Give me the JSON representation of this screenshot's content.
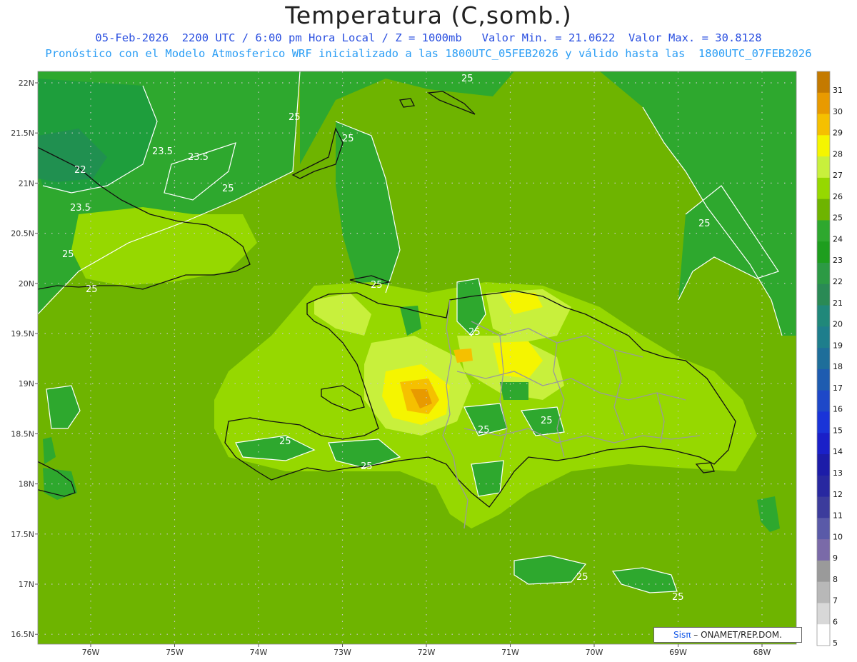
{
  "title": "Temperatura (C,somb.)",
  "subtitle_line1": "05-Feb-2026  2200 UTC / 6:00 pm Hora Local / Z = 1000mb   Valor Min. = 21.0622  Valor Max. = 30.8128",
  "subtitle_line2": "Pronóstico con el Modelo Atmosferico WRF inicializado a las 1800UTC_05FEB2026 y válido hasta las  1800UTC_07FEB2026",
  "credit": {
    "logo": "Sisπ",
    "text": "– ONAMET/REP.DOM."
  },
  "lat_labels": [
    "22N",
    "21.5N",
    "21N",
    "20.5N",
    "20N",
    "19.5N",
    "19N",
    "18.5N",
    "18N",
    "17.5N",
    "17N",
    "16.5N"
  ],
  "lon_labels": [
    "76W",
    "75W",
    "74W",
    "73W",
    "72W",
    "71W",
    "70W",
    "69W",
    "68W"
  ],
  "contour_labels": [
    {
      "text": "25",
      "role": "north"
    },
    {
      "text": "25",
      "role": "bahamas-1"
    },
    {
      "text": "25",
      "role": "bahamas-2"
    },
    {
      "text": "23.5",
      "role": "cuba-1"
    },
    {
      "text": "23.5",
      "role": "cuba-2"
    },
    {
      "text": "22",
      "role": "cuba-3"
    },
    {
      "text": "23.5",
      "role": "cuba-4"
    },
    {
      "text": "25",
      "role": "cuba-5"
    },
    {
      "text": "25",
      "role": "cuba-6"
    },
    {
      "text": "25",
      "role": "cuba-7"
    },
    {
      "text": "25",
      "role": "atlantic"
    },
    {
      "text": "25",
      "role": "haiti-north"
    },
    {
      "text": "25",
      "role": "dr-north"
    },
    {
      "text": "25",
      "role": "haiti-south"
    },
    {
      "text": "25",
      "role": "haiti-south-2"
    },
    {
      "text": "25",
      "role": "dr-central"
    },
    {
      "text": "25",
      "role": "dr-east"
    },
    {
      "text": "25",
      "role": "pr-west"
    },
    {
      "text": "25",
      "role": "pr-east"
    }
  ],
  "colorbar": {
    "labels": [
      "31",
      "30",
      "29",
      "28",
      "27",
      "26",
      "25",
      "24",
      "23",
      "22",
      "21",
      "20",
      "19",
      "18",
      "17",
      "16",
      "15",
      "14",
      "13",
      "12",
      "11",
      "10",
      "9",
      "8",
      "7",
      "6",
      "5"
    ],
    "colors": [
      "#c47a00",
      "#e89a00",
      "#f5c000",
      "#f5f500",
      "#c8f03c",
      "#96d800",
      "#6eb400",
      "#2ea82e",
      "#1e9e1e",
      "#2c9a44",
      "#2a8a55",
      "#20887a",
      "#1e7e8c",
      "#1e6e9a",
      "#1e5cb0",
      "#1e48c8",
      "#1a34d8",
      "#1a20c8",
      "#1c1ca8",
      "#2828a0",
      "#3c3c9c",
      "#5a5aa8",
      "#7a6aa8",
      "#9a9a9a",
      "#b8b8b8",
      "#d8d8d8",
      "#ffffff"
    ]
  },
  "palette": {
    "sea_base": "#6eb400",
    "cool_green": "#2ea82e",
    "cooler_green": "#1e9e3c",
    "coolest_green": "#209050",
    "warm_1": "#96d800",
    "warm_2": "#c8f03c",
    "warm_3": "#f5f500",
    "warm_4": "#f5c000",
    "warm_5": "#e89a00",
    "grid": "#bbbbbb",
    "coast": "#111111",
    "province": "#9a9a9a",
    "contour": "#ffffff"
  }
}
